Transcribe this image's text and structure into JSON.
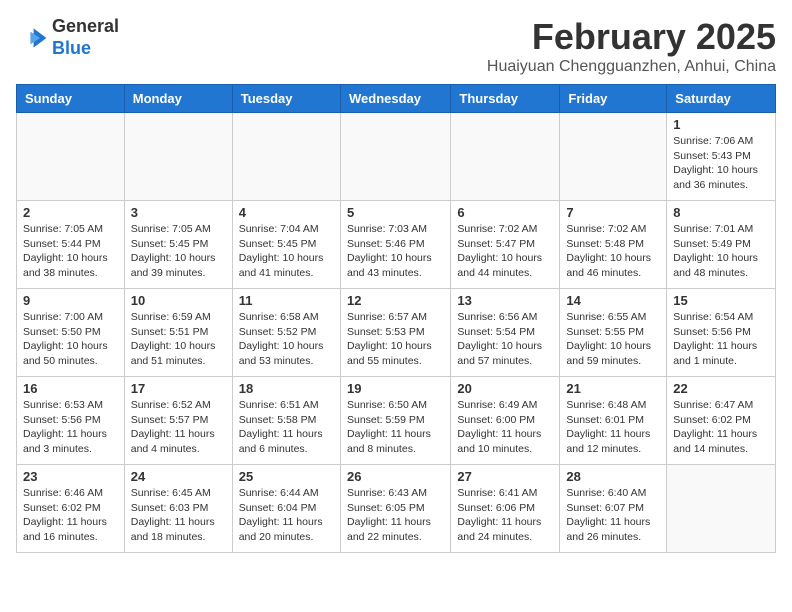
{
  "logo": {
    "line1": "General",
    "line2": "Blue"
  },
  "title": "February 2025",
  "location": "Huaiyuan Chengguanzhen, Anhui, China",
  "weekdays": [
    "Sunday",
    "Monday",
    "Tuesday",
    "Wednesday",
    "Thursday",
    "Friday",
    "Saturday"
  ],
  "weeks": [
    [
      {
        "day": "",
        "info": ""
      },
      {
        "day": "",
        "info": ""
      },
      {
        "day": "",
        "info": ""
      },
      {
        "day": "",
        "info": ""
      },
      {
        "day": "",
        "info": ""
      },
      {
        "day": "",
        "info": ""
      },
      {
        "day": "1",
        "info": "Sunrise: 7:06 AM\nSunset: 5:43 PM\nDaylight: 10 hours\nand 36 minutes."
      }
    ],
    [
      {
        "day": "2",
        "info": "Sunrise: 7:05 AM\nSunset: 5:44 PM\nDaylight: 10 hours\nand 38 minutes."
      },
      {
        "day": "3",
        "info": "Sunrise: 7:05 AM\nSunset: 5:45 PM\nDaylight: 10 hours\nand 39 minutes."
      },
      {
        "day": "4",
        "info": "Sunrise: 7:04 AM\nSunset: 5:45 PM\nDaylight: 10 hours\nand 41 minutes."
      },
      {
        "day": "5",
        "info": "Sunrise: 7:03 AM\nSunset: 5:46 PM\nDaylight: 10 hours\nand 43 minutes."
      },
      {
        "day": "6",
        "info": "Sunrise: 7:02 AM\nSunset: 5:47 PM\nDaylight: 10 hours\nand 44 minutes."
      },
      {
        "day": "7",
        "info": "Sunrise: 7:02 AM\nSunset: 5:48 PM\nDaylight: 10 hours\nand 46 minutes."
      },
      {
        "day": "8",
        "info": "Sunrise: 7:01 AM\nSunset: 5:49 PM\nDaylight: 10 hours\nand 48 minutes."
      }
    ],
    [
      {
        "day": "9",
        "info": "Sunrise: 7:00 AM\nSunset: 5:50 PM\nDaylight: 10 hours\nand 50 minutes."
      },
      {
        "day": "10",
        "info": "Sunrise: 6:59 AM\nSunset: 5:51 PM\nDaylight: 10 hours\nand 51 minutes."
      },
      {
        "day": "11",
        "info": "Sunrise: 6:58 AM\nSunset: 5:52 PM\nDaylight: 10 hours\nand 53 minutes."
      },
      {
        "day": "12",
        "info": "Sunrise: 6:57 AM\nSunset: 5:53 PM\nDaylight: 10 hours\nand 55 minutes."
      },
      {
        "day": "13",
        "info": "Sunrise: 6:56 AM\nSunset: 5:54 PM\nDaylight: 10 hours\nand 57 minutes."
      },
      {
        "day": "14",
        "info": "Sunrise: 6:55 AM\nSunset: 5:55 PM\nDaylight: 10 hours\nand 59 minutes."
      },
      {
        "day": "15",
        "info": "Sunrise: 6:54 AM\nSunset: 5:56 PM\nDaylight: 11 hours\nand 1 minute."
      }
    ],
    [
      {
        "day": "16",
        "info": "Sunrise: 6:53 AM\nSunset: 5:56 PM\nDaylight: 11 hours\nand 3 minutes."
      },
      {
        "day": "17",
        "info": "Sunrise: 6:52 AM\nSunset: 5:57 PM\nDaylight: 11 hours\nand 4 minutes."
      },
      {
        "day": "18",
        "info": "Sunrise: 6:51 AM\nSunset: 5:58 PM\nDaylight: 11 hours\nand 6 minutes."
      },
      {
        "day": "19",
        "info": "Sunrise: 6:50 AM\nSunset: 5:59 PM\nDaylight: 11 hours\nand 8 minutes."
      },
      {
        "day": "20",
        "info": "Sunrise: 6:49 AM\nSunset: 6:00 PM\nDaylight: 11 hours\nand 10 minutes."
      },
      {
        "day": "21",
        "info": "Sunrise: 6:48 AM\nSunset: 6:01 PM\nDaylight: 11 hours\nand 12 minutes."
      },
      {
        "day": "22",
        "info": "Sunrise: 6:47 AM\nSunset: 6:02 PM\nDaylight: 11 hours\nand 14 minutes."
      }
    ],
    [
      {
        "day": "23",
        "info": "Sunrise: 6:46 AM\nSunset: 6:02 PM\nDaylight: 11 hours\nand 16 minutes."
      },
      {
        "day": "24",
        "info": "Sunrise: 6:45 AM\nSunset: 6:03 PM\nDaylight: 11 hours\nand 18 minutes."
      },
      {
        "day": "25",
        "info": "Sunrise: 6:44 AM\nSunset: 6:04 PM\nDaylight: 11 hours\nand 20 minutes."
      },
      {
        "day": "26",
        "info": "Sunrise: 6:43 AM\nSunset: 6:05 PM\nDaylight: 11 hours\nand 22 minutes."
      },
      {
        "day": "27",
        "info": "Sunrise: 6:41 AM\nSunset: 6:06 PM\nDaylight: 11 hours\nand 24 minutes."
      },
      {
        "day": "28",
        "info": "Sunrise: 6:40 AM\nSunset: 6:07 PM\nDaylight: 11 hours\nand 26 minutes."
      },
      {
        "day": "",
        "info": ""
      }
    ]
  ]
}
